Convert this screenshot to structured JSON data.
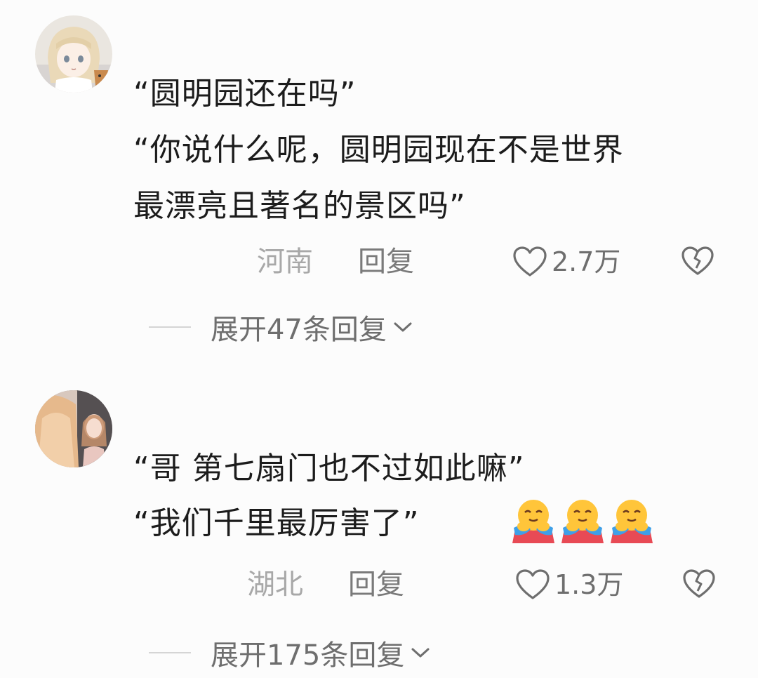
{
  "comments": [
    {
      "text_lines": [
        "“圆明园还在吗”",
        "“你说什么呢，圆明园现在不是世界",
        "最漂亮且著名的景区吗”"
      ],
      "location": "河南",
      "reply_label": "回复",
      "likes": "2.7万",
      "expand_label": "展开47条回复"
    },
    {
      "text_lines": [
        "“哥 第七扇门也不过如此嘛”",
        "“我们千里最厉害了”"
      ],
      "emojis": [
        "hugging-emoji",
        "hugging-emoji",
        "hugging-emoji"
      ],
      "location": "湖北",
      "reply_label": "回复",
      "likes": "1.3万",
      "expand_label": "展开175条回复"
    }
  ],
  "icons": {
    "like": "heart-outline-icon",
    "dislike": "broken-heart-icon",
    "expand": "chevron-down-icon"
  },
  "colors": {
    "background": "#fcfcfc",
    "text": "#1c1c1c",
    "location": "#a8a8a8",
    "secondary": "#6e6e6e"
  }
}
